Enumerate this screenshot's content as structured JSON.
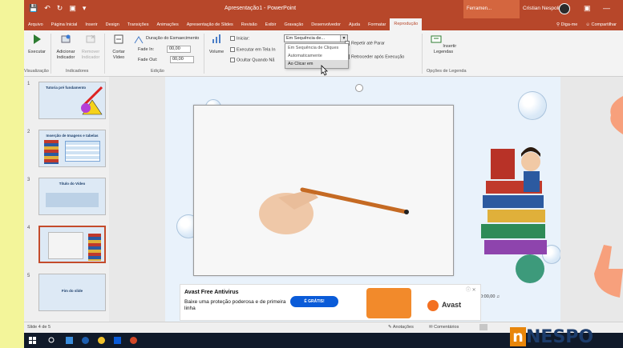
{
  "title_bar": {
    "doc_title": "Apresentação1 - PowerPoint",
    "context_tab": "Ferramen...",
    "user_name": "Cristian Nespoli"
  },
  "menu": {
    "tabs": [
      "Arquivo",
      "Página Inicial",
      "Inserir",
      "Design",
      "Transições",
      "Animações",
      "Apresentação de Slides",
      "Revisão",
      "Exibir",
      "Gravação",
      "Desenvolvedor",
      "Ajuda",
      "Formatar",
      "Reprodução"
    ],
    "active_tab": "Reprodução",
    "tell_me": "Diga-me",
    "share": "Compartilhar"
  },
  "ribbon": {
    "play": "Executar",
    "add_bookmark": "Adicionar Indicador",
    "remove_bookmark": "Remover Indicador",
    "trim_video": "Cortar Vídeo",
    "fade_duration": "Duração do Esmaecimento",
    "fade_in_label": "Fade In:",
    "fade_in_value": "00,00",
    "fade_out_label": "Fade Out:",
    "fade_out_value": "00,00",
    "volume": "Volume",
    "start_label": "Iniciar:",
    "start_value": "Em Sequência de...",
    "fullscreen": "Executar em Tela In",
    "hide_when_not_playing": "Ocultar Quando Nã",
    "loop_until_stopped": "Repetir até Parar",
    "rewind_after_playing": "Retroceder após Execução",
    "insert_captions": "Insertir Legendas",
    "groups": {
      "preview": "Visualização",
      "bookmarks": "Indicadores",
      "editing": "Edição",
      "caption_options": "Opções de Legenda"
    }
  },
  "dropdown": {
    "options": [
      "Em Sequência de Cliques",
      "Automaticamente",
      "Ao Clicar em"
    ],
    "hovered": "Ao Clicar em"
  },
  "slides": [
    {
      "number": "1",
      "title": "Tutoria pré fundamento"
    },
    {
      "number": "2",
      "title": "Inserção de Imagens e tabelas"
    },
    {
      "number": "3",
      "title": "Título do Vídeo"
    },
    {
      "number": "4",
      "title": ""
    },
    {
      "number": "5",
      "title": "Fim do slide"
    }
  ],
  "ad": {
    "title": "Avast Free Antivirus",
    "body": "Baixe uma proteção poderosa e de primeira linha",
    "button": "É GRÁTIS!",
    "brand": "Avast"
  },
  "video_time": "00:00,00",
  "status": {
    "slide_count": "Slide 4 de 5",
    "notes": "Anotações",
    "comments": "Comentários"
  },
  "watermark": {
    "letter": "n",
    "text": "NESPO"
  },
  "colors": {
    "accent": "#b7472a",
    "brand_orange": "#e8860b"
  }
}
